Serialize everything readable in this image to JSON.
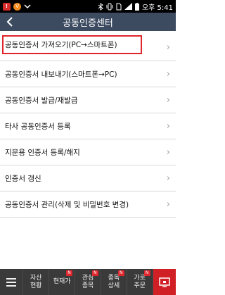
{
  "status_bar": {
    "left_icons": [
      "warning-badge",
      "vaccine-badge",
      "expand-down"
    ],
    "right_icons": [
      "bluetooth",
      "vibrate",
      "sim",
      "signal",
      "battery"
    ],
    "time": "오후 5:41",
    "left_badge_1": "!",
    "left_badge_2": "V"
  },
  "header": {
    "title": "공동인증센터",
    "back_icon": "chevron-left"
  },
  "menu": {
    "items": [
      {
        "label": "공동인증서 가져오기(PC→스마트폰)"
      },
      {
        "label": "공동인증서 내보내기(스마트폰→PC)"
      },
      {
        "label": "공동인증서 발급/재발급"
      },
      {
        "label": "타사 공동인증서 등록"
      },
      {
        "label": "지문용 인증서 등록/해지"
      },
      {
        "label": "인증서 갱신"
      },
      {
        "label": "공동인증서 관리(삭제 및 비밀번호 변경)"
      }
    ],
    "chevron": "›"
  },
  "bottom_nav": {
    "menu_icon": "hamburger",
    "items": [
      {
        "line1": "자산",
        "line2": "현황",
        "badge": ""
      },
      {
        "line1": "현재가",
        "line2": "",
        "badge": "N"
      },
      {
        "line1": "관심",
        "line2": "종목",
        "badge": "N"
      },
      {
        "line1": "종목",
        "line2": "상세",
        "badge": "N"
      },
      {
        "line1": "가로",
        "line2": "주문",
        "badge": "N"
      }
    ],
    "right_icon": "screen-lock"
  },
  "colors": {
    "header_bg": "#3d4b61",
    "selection_border": "#e0252d",
    "nav_bg": "#3a3a3a",
    "nav_accent": "#d11f26"
  }
}
